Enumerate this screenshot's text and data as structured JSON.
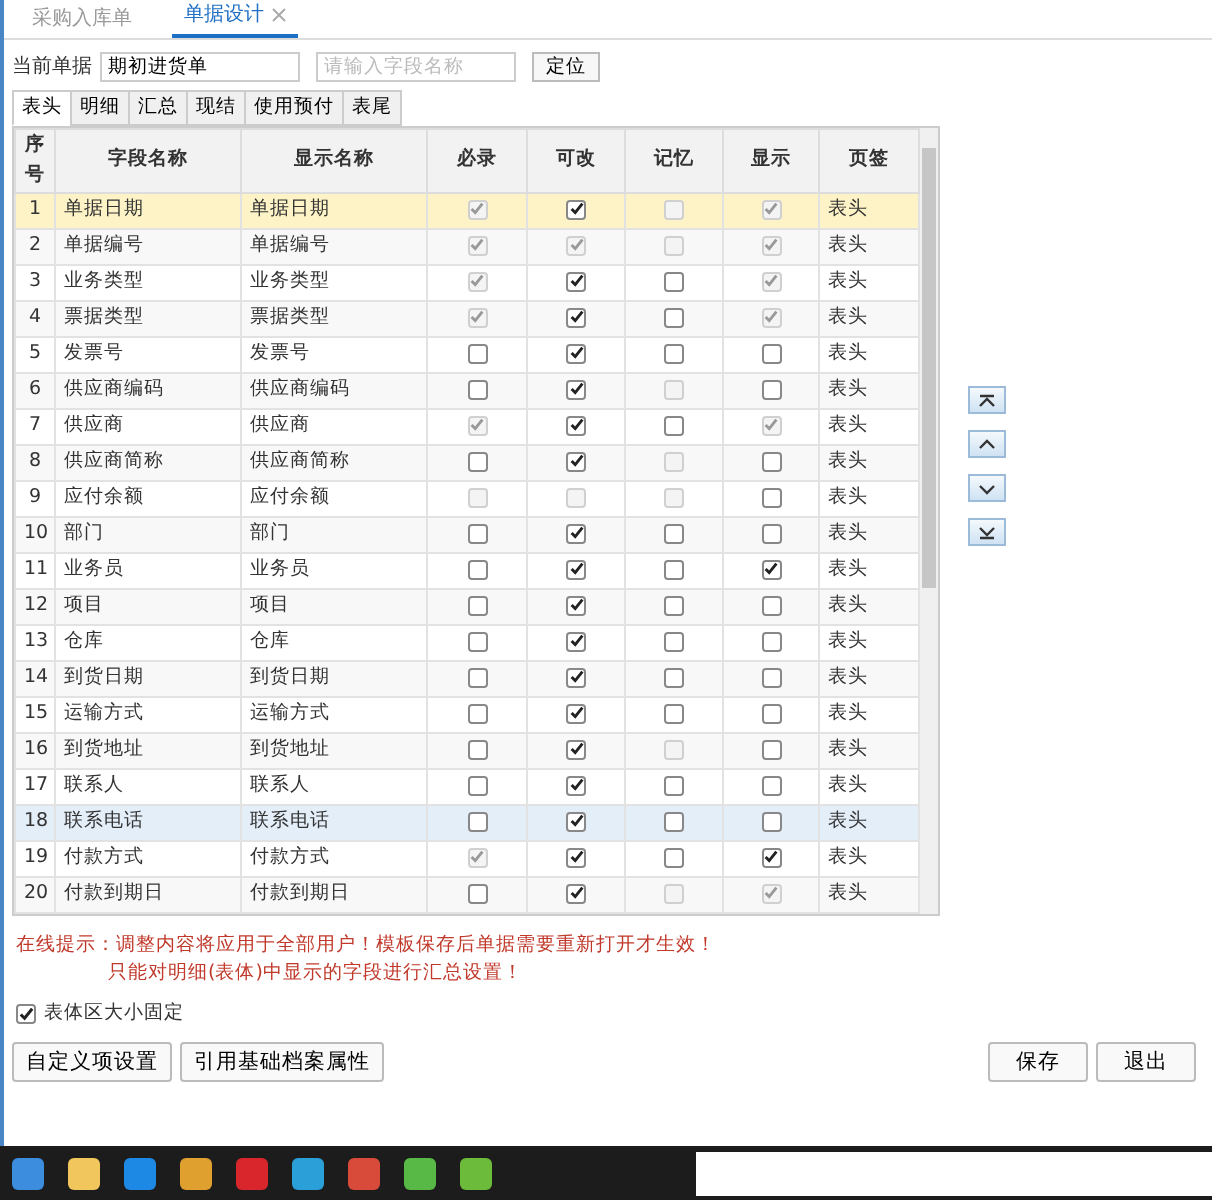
{
  "doc_tabs": [
    {
      "label": "采购入库单",
      "selected": false,
      "closable": false
    },
    {
      "label": "单据设计",
      "selected": true,
      "closable": true
    }
  ],
  "toolbar": {
    "label": "当前单据",
    "document": "期初进货单",
    "search_placeholder": "请输入字段名称",
    "locate_button": "定位"
  },
  "section_tabs": [
    {
      "label": "表头",
      "selected": true
    },
    {
      "label": "明细",
      "selected": false
    },
    {
      "label": "汇总",
      "selected": false
    },
    {
      "label": "现结",
      "selected": false
    },
    {
      "label": "使用预付",
      "selected": false
    },
    {
      "label": "表尾",
      "selected": false
    }
  ],
  "table": {
    "columns": [
      "序号",
      "字段名称",
      "显示名称",
      "必录",
      "可改",
      "记忆",
      "显示",
      "页签"
    ],
    "rows": [
      {
        "no": "1",
        "field": "单据日期",
        "display": "单据日期",
        "flags": [
          {
            "checked": true,
            "disabled": true
          },
          {
            "checked": true,
            "disabled": false
          },
          {
            "checked": false,
            "disabled": true
          },
          {
            "checked": true,
            "disabled": true
          }
        ],
        "page": "表头",
        "selected": true,
        "hovered": false
      },
      {
        "no": "2",
        "field": "单据编号",
        "display": "单据编号",
        "flags": [
          {
            "checked": true,
            "disabled": true
          },
          {
            "checked": true,
            "disabled": true
          },
          {
            "checked": false,
            "disabled": true
          },
          {
            "checked": true,
            "disabled": true
          }
        ],
        "page": "表头",
        "selected": false,
        "hovered": false
      },
      {
        "no": "3",
        "field": "业务类型",
        "display": "业务类型",
        "flags": [
          {
            "checked": true,
            "disabled": true
          },
          {
            "checked": true,
            "disabled": false
          },
          {
            "checked": false,
            "disabled": false
          },
          {
            "checked": true,
            "disabled": true
          }
        ],
        "page": "表头",
        "selected": false,
        "hovered": false
      },
      {
        "no": "4",
        "field": "票据类型",
        "display": "票据类型",
        "flags": [
          {
            "checked": true,
            "disabled": true
          },
          {
            "checked": true,
            "disabled": false
          },
          {
            "checked": false,
            "disabled": false
          },
          {
            "checked": true,
            "disabled": true
          }
        ],
        "page": "表头",
        "selected": false,
        "hovered": false
      },
      {
        "no": "5",
        "field": "发票号",
        "display": "发票号",
        "flags": [
          {
            "checked": false,
            "disabled": false
          },
          {
            "checked": true,
            "disabled": false
          },
          {
            "checked": false,
            "disabled": false
          },
          {
            "checked": false,
            "disabled": false
          }
        ],
        "page": "表头",
        "selected": false,
        "hovered": false
      },
      {
        "no": "6",
        "field": "供应商编码",
        "display": "供应商编码",
        "flags": [
          {
            "checked": false,
            "disabled": false
          },
          {
            "checked": true,
            "disabled": false
          },
          {
            "checked": false,
            "disabled": true
          },
          {
            "checked": false,
            "disabled": false
          }
        ],
        "page": "表头",
        "selected": false,
        "hovered": false
      },
      {
        "no": "7",
        "field": "供应商",
        "display": "供应商",
        "flags": [
          {
            "checked": true,
            "disabled": true
          },
          {
            "checked": true,
            "disabled": false
          },
          {
            "checked": false,
            "disabled": false
          },
          {
            "checked": true,
            "disabled": true
          }
        ],
        "page": "表头",
        "selected": false,
        "hovered": false
      },
      {
        "no": "8",
        "field": "供应商简称",
        "display": "供应商简称",
        "flags": [
          {
            "checked": false,
            "disabled": false
          },
          {
            "checked": true,
            "disabled": false
          },
          {
            "checked": false,
            "disabled": true
          },
          {
            "checked": false,
            "disabled": false
          }
        ],
        "page": "表头",
        "selected": false,
        "hovered": false
      },
      {
        "no": "9",
        "field": "应付余额",
        "display": "应付余额",
        "flags": [
          {
            "checked": false,
            "disabled": true
          },
          {
            "checked": false,
            "disabled": true
          },
          {
            "checked": false,
            "disabled": true
          },
          {
            "checked": false,
            "disabled": false
          }
        ],
        "page": "表头",
        "selected": false,
        "hovered": false
      },
      {
        "no": "10",
        "field": "部门",
        "display": "部门",
        "flags": [
          {
            "checked": false,
            "disabled": false
          },
          {
            "checked": true,
            "disabled": false
          },
          {
            "checked": false,
            "disabled": false
          },
          {
            "checked": false,
            "disabled": false
          }
        ],
        "page": "表头",
        "selected": false,
        "hovered": false
      },
      {
        "no": "11",
        "field": "业务员",
        "display": "业务员",
        "flags": [
          {
            "checked": false,
            "disabled": false
          },
          {
            "checked": true,
            "disabled": false
          },
          {
            "checked": false,
            "disabled": false
          },
          {
            "checked": true,
            "disabled": false
          }
        ],
        "page": "表头",
        "selected": false,
        "hovered": false
      },
      {
        "no": "12",
        "field": "项目",
        "display": "项目",
        "flags": [
          {
            "checked": false,
            "disabled": false
          },
          {
            "checked": true,
            "disabled": false
          },
          {
            "checked": false,
            "disabled": false
          },
          {
            "checked": false,
            "disabled": false
          }
        ],
        "page": "表头",
        "selected": false,
        "hovered": false
      },
      {
        "no": "13",
        "field": "仓库",
        "display": "仓库",
        "flags": [
          {
            "checked": false,
            "disabled": false
          },
          {
            "checked": true,
            "disabled": false
          },
          {
            "checked": false,
            "disabled": false
          },
          {
            "checked": false,
            "disabled": false
          }
        ],
        "page": "表头",
        "selected": false,
        "hovered": false
      },
      {
        "no": "14",
        "field": "到货日期",
        "display": "到货日期",
        "flags": [
          {
            "checked": false,
            "disabled": false
          },
          {
            "checked": true,
            "disabled": false
          },
          {
            "checked": false,
            "disabled": false
          },
          {
            "checked": false,
            "disabled": false
          }
        ],
        "page": "表头",
        "selected": false,
        "hovered": false
      },
      {
        "no": "15",
        "field": "运输方式",
        "display": "运输方式",
        "flags": [
          {
            "checked": false,
            "disabled": false
          },
          {
            "checked": true,
            "disabled": false
          },
          {
            "checked": false,
            "disabled": false
          },
          {
            "checked": false,
            "disabled": false
          }
        ],
        "page": "表头",
        "selected": false,
        "hovered": false
      },
      {
        "no": "16",
        "field": "到货地址",
        "display": "到货地址",
        "flags": [
          {
            "checked": false,
            "disabled": false
          },
          {
            "checked": true,
            "disabled": false
          },
          {
            "checked": false,
            "disabled": true
          },
          {
            "checked": false,
            "disabled": false
          }
        ],
        "page": "表头",
        "selected": false,
        "hovered": false
      },
      {
        "no": "17",
        "field": "联系人",
        "display": "联系人",
        "flags": [
          {
            "checked": false,
            "disabled": false
          },
          {
            "checked": true,
            "disabled": false
          },
          {
            "checked": false,
            "disabled": false
          },
          {
            "checked": false,
            "disabled": false
          }
        ],
        "page": "表头",
        "selected": false,
        "hovered": false
      },
      {
        "no": "18",
        "field": "联系电话",
        "display": "联系电话",
        "flags": [
          {
            "checked": false,
            "disabled": false
          },
          {
            "checked": true,
            "disabled": false
          },
          {
            "checked": false,
            "disabled": false
          },
          {
            "checked": false,
            "disabled": false
          }
        ],
        "page": "表头",
        "selected": false,
        "hovered": true
      },
      {
        "no": "19",
        "field": "付款方式",
        "display": "付款方式",
        "flags": [
          {
            "checked": true,
            "disabled": true
          },
          {
            "checked": true,
            "disabled": false
          },
          {
            "checked": false,
            "disabled": false
          },
          {
            "checked": true,
            "disabled": false
          }
        ],
        "page": "表头",
        "selected": false,
        "hovered": false
      },
      {
        "no": "20",
        "field": "付款到期日",
        "display": "付款到期日",
        "flags": [
          {
            "checked": false,
            "disabled": false
          },
          {
            "checked": true,
            "disabled": false
          },
          {
            "checked": false,
            "disabled": true
          },
          {
            "checked": true,
            "disabled": true
          }
        ],
        "page": "表头",
        "selected": false,
        "hovered": false
      }
    ]
  },
  "hint": {
    "label": "在线提示：",
    "lines": [
      "调整内容将应用于全部用户！模板保存后单据需要重新打开才生效！",
      "只能对明细(表体)中显示的字段进行汇总设置！"
    ]
  },
  "fixed_size": {
    "label": "表体区大小固定",
    "checked": true
  },
  "left_buttons": [
    "自定义项设置",
    "引用基础档案属性"
  ],
  "right_buttons": [
    "保存",
    "退出"
  ]
}
